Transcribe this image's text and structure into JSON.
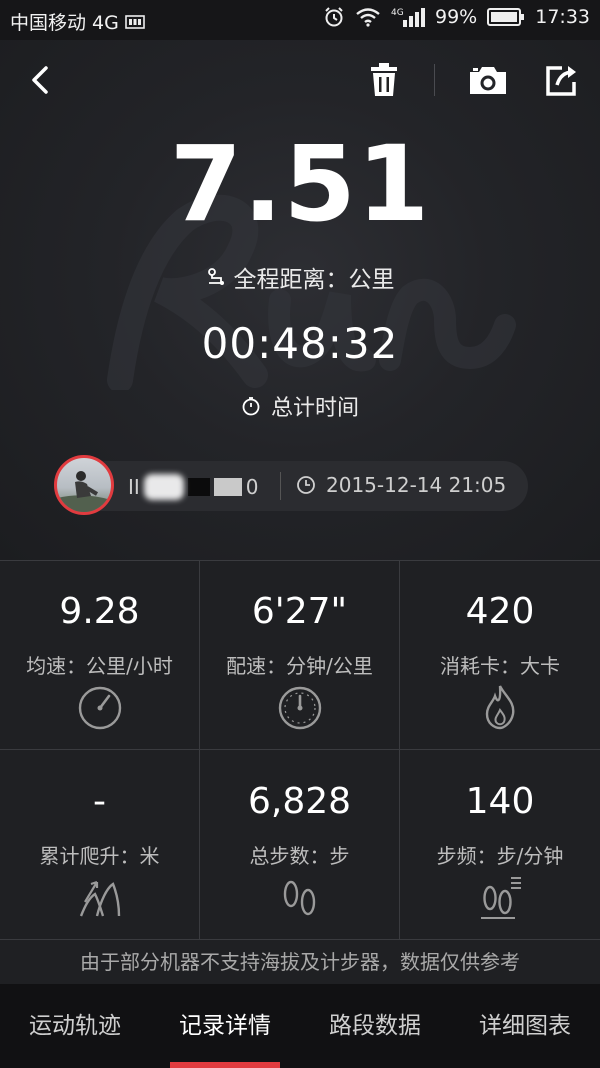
{
  "status_bar": {
    "carrier": "中国移动 4G",
    "battery": "99%",
    "time": "17:33",
    "icons": [
      "alarm-icon",
      "wifi-icon",
      "signal-4g-icon",
      "battery-icon"
    ]
  },
  "toolbar": {
    "icons": [
      "back-icon",
      "trash-icon",
      "camera-icon",
      "share-icon"
    ]
  },
  "hero": {
    "watermark": "Run",
    "distance_value": "7.51",
    "distance_label": "全程距离：公里",
    "duration_value": "00:48:32",
    "duration_label": "总计时间"
  },
  "user": {
    "name_visible_prefix": "II",
    "name_visible_suffix": "0",
    "datetime": "2015-12-14 21:05"
  },
  "stats": [
    {
      "value": "9.28",
      "label": "均速：公里/小时",
      "icon": "speedometer-icon"
    },
    {
      "value": "6'27\"",
      "label": "配速：分钟/公里",
      "icon": "gauge-icon"
    },
    {
      "value": "420",
      "label": "消耗卡：大卡",
      "icon": "flame-icon"
    },
    {
      "value": "-",
      "label": "累计爬升：米",
      "icon": "climb-icon"
    },
    {
      "value": "6,828",
      "label": "总步数：步",
      "icon": "footprints-icon"
    },
    {
      "value": "140",
      "label": "步频：步/分钟",
      "icon": "cadence-icon"
    }
  ],
  "disclaimer": "由于部分机器不支持海拔及计步器，数据仅供参考",
  "tabs": [
    {
      "label": "运动轨迹",
      "active": false
    },
    {
      "label": "记录详情",
      "active": true
    },
    {
      "label": "路段数据",
      "active": false
    },
    {
      "label": "详细图表",
      "active": false
    }
  ],
  "colors": {
    "accent": "#e13b3f",
    "background": "#1a1a1c",
    "text_secondary": "#bdbdbd"
  }
}
